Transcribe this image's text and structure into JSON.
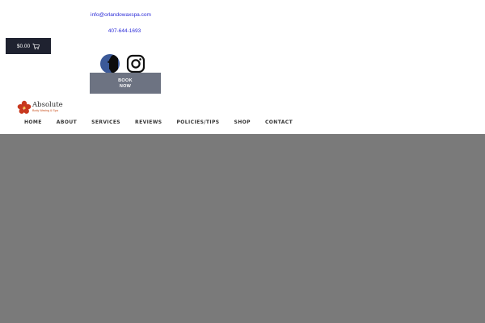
{
  "contact": {
    "email": "info@orlandowaxspa.com",
    "phone": "407-644-1693"
  },
  "cart": {
    "total": "$0.00",
    "icon": "cart-icon"
  },
  "social": {
    "facebook_icon": "facebook-icon",
    "instagram_icon": "instagram-icon"
  },
  "book_button": {
    "line1": "BOOK",
    "line2": "NOW"
  },
  "logo": {
    "name": "Absolute",
    "tagline": "Body Waxing & Spa"
  },
  "nav": {
    "items": [
      "HOME",
      "ABOUT",
      "SERVICES",
      "REVIEWS",
      "POLICIES/TIPS",
      "SHOP",
      "CONTACT"
    ]
  },
  "colors": {
    "link": "#2b2bd8",
    "cart_bg": "#1f2230",
    "book_bg": "#6d7382",
    "facebook": "#3b5998",
    "brand_accent": "#c8501e",
    "hero_bg": "#7a7a7a"
  }
}
